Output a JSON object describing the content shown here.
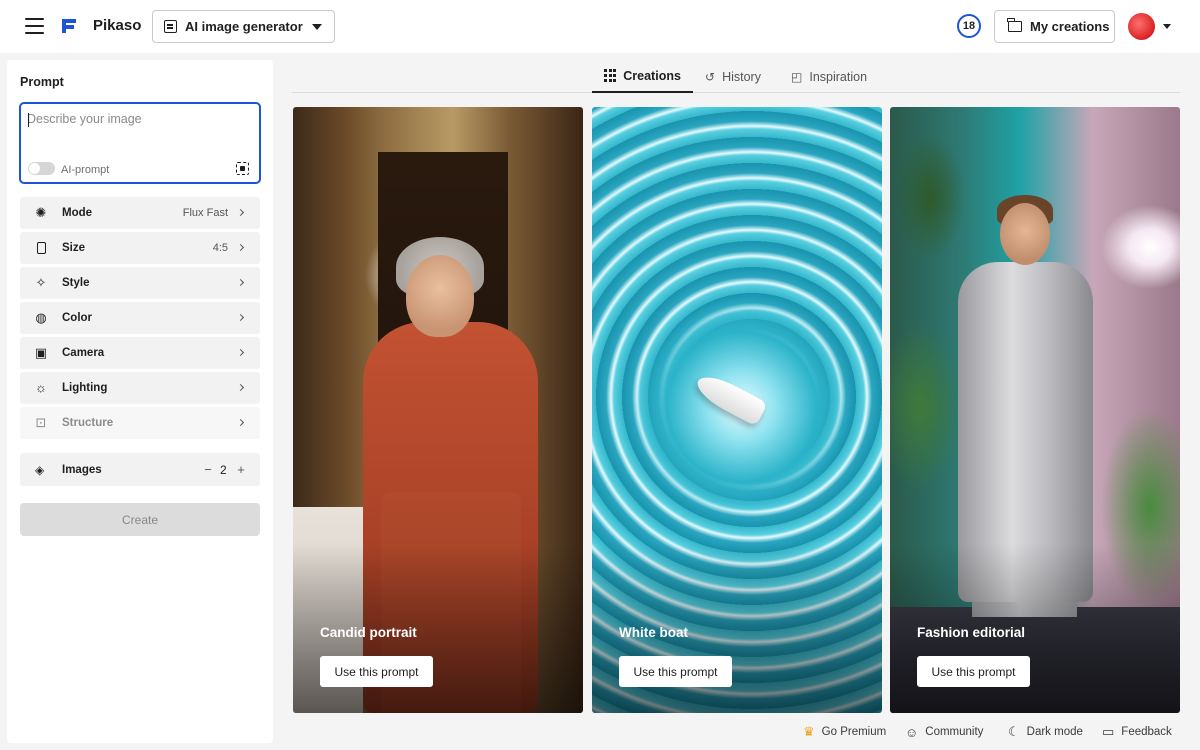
{
  "header": {
    "brand": "Pikaso",
    "tool_select": "AI image generator",
    "credits": "18",
    "my_creations": "My creations"
  },
  "prompt": {
    "title": "Prompt",
    "placeholder": "Describe your image",
    "ai_prompt_label": "AI-prompt"
  },
  "options": [
    {
      "label": "Mode",
      "value": "Flux Fast",
      "icon": "mode-icon"
    },
    {
      "label": "Size",
      "value": "4:5",
      "icon": "size-icon"
    },
    {
      "label": "Style",
      "value": "",
      "icon": "style-icon"
    },
    {
      "label": "Color",
      "value": "",
      "icon": "palette-icon"
    },
    {
      "label": "Camera",
      "value": "",
      "icon": "camera-icon"
    },
    {
      "label": "Lighting",
      "value": "",
      "icon": "lighting-icon"
    },
    {
      "label": "Structure",
      "value": "",
      "icon": "structure-icon"
    }
  ],
  "images": {
    "label": "Images",
    "count": "2",
    "minus": "−",
    "plus": "+"
  },
  "create_label": "Create",
  "tabs": [
    {
      "label": "Creations",
      "active": true
    },
    {
      "label": "History",
      "active": false
    },
    {
      "label": "Inspiration",
      "active": false
    }
  ],
  "cards": [
    {
      "title": "Candid portrait",
      "button": "Use this prompt"
    },
    {
      "title": "White boat",
      "button": "Use this prompt"
    },
    {
      "title": "Fashion editorial",
      "button": "Use this prompt"
    }
  ],
  "footer": {
    "premium": "Go Premium",
    "community": "Community",
    "dark_mode": "Dark mode",
    "feedback": "Feedback"
  },
  "colors": {
    "accent": "#1b54d6",
    "brand_red": "#d92222",
    "crown": "#f0a21a"
  }
}
